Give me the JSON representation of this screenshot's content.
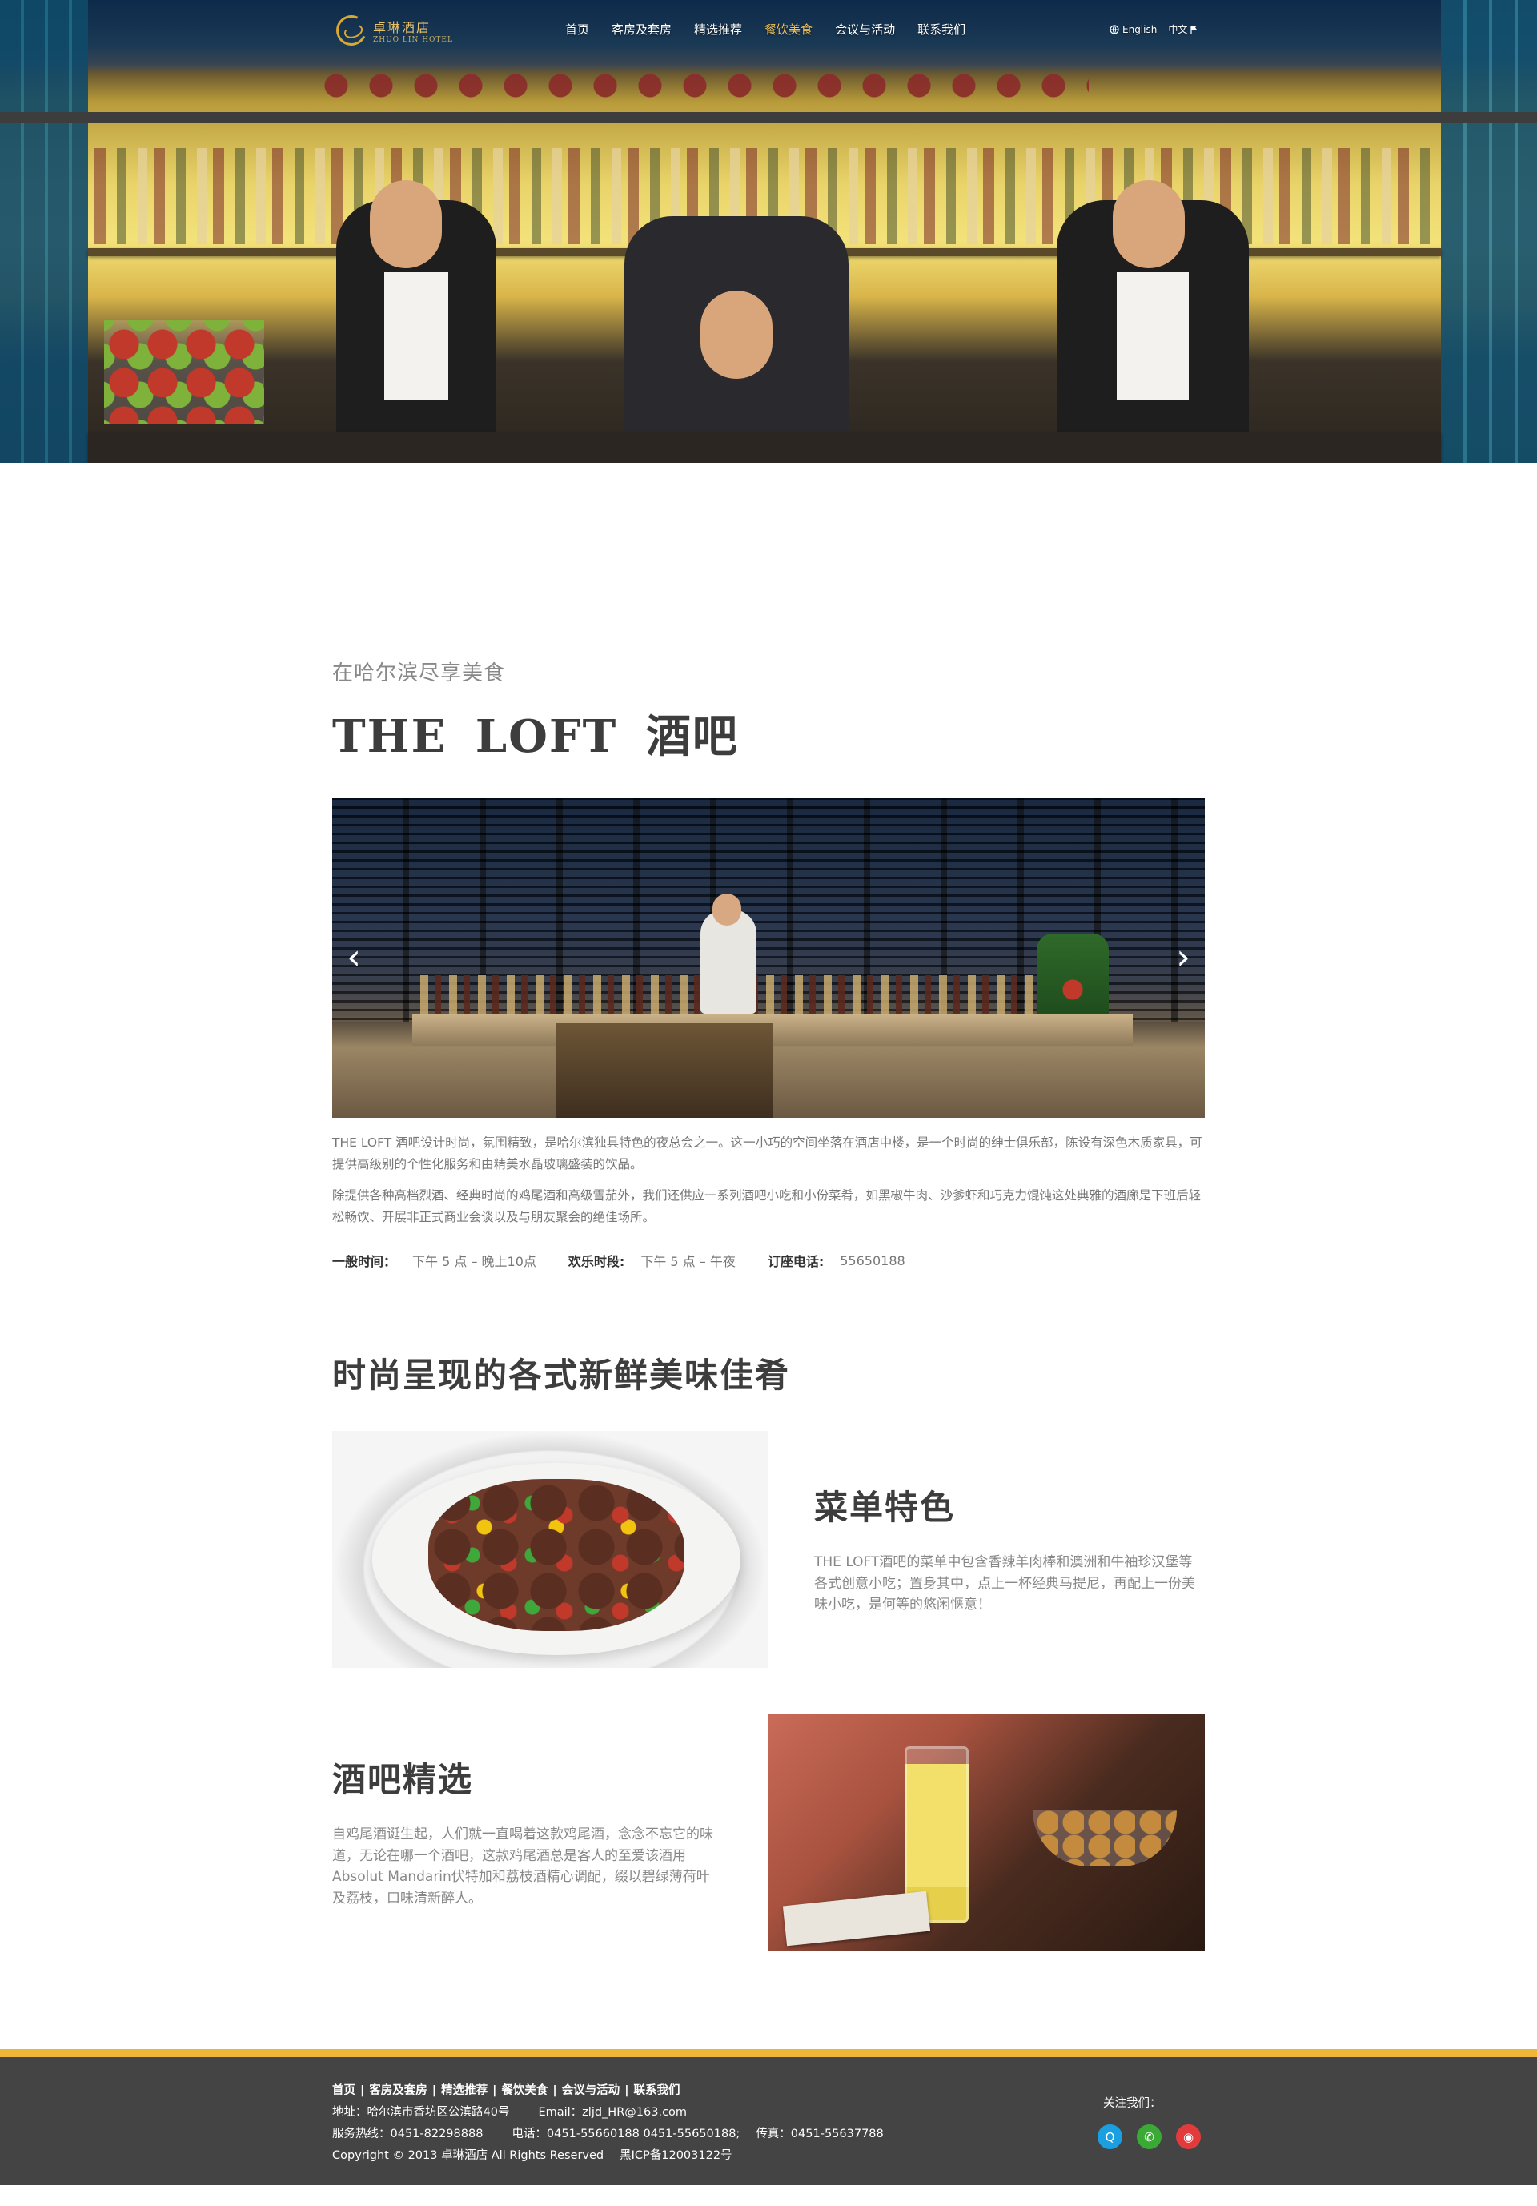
{
  "header": {
    "logo_name": "卓琳酒店",
    "logo_sub": "ZHUO LIN HOTEL",
    "nav": [
      {
        "label": "首页",
        "active": false
      },
      {
        "label": "客房及套房",
        "active": false
      },
      {
        "label": "精选推荐",
        "active": false
      },
      {
        "label": "餐饮美食",
        "active": true
      },
      {
        "label": "会议与活动",
        "active": false
      },
      {
        "label": "联系我们",
        "active": false
      }
    ],
    "lang": {
      "en": "English",
      "cn": "中文"
    }
  },
  "main": {
    "subtitle": "在哈尔滨尽享美食",
    "title": "THE LOFT 酒吧",
    "slider": {
      "prev": "‹",
      "next": "›"
    },
    "desc": [
      "THE LOFT 酒吧设计时尚，氛围精致，是哈尔滨独具特色的夜总会之一。这一小巧的空间坐落在酒店中楼，是一个时尚的绅士俱乐部，陈设有深色木质家具，可提供高级别的个性化服务和由精美水晶玻璃盛装的饮品。",
      "除提供各种高档烈酒、经典时尚的鸡尾酒和高级雪茄外，我们还供应一系列酒吧小吃和小份菜肴，如黑椒牛肉、沙爹虾和巧克力馄饨这处典雅的酒廊是下班后轻松畅饮、开展非正式商业会谈以及与朋友聚会的绝佳场所。"
    ],
    "info": [
      {
        "k": "一般时间：",
        "v": "下午 5 点 – 晚上10点"
      },
      {
        "k": "欢乐时段:",
        "v": "下午 5 点 – 午夜"
      },
      {
        "k": "订座电话:",
        "v": "55650188"
      }
    ],
    "section_title": "时尚呈现的各式新鲜美味佳肴",
    "features": [
      {
        "title": "菜单特色",
        "text": "THE LOFT酒吧的菜单中包含香辣羊肉棒和澳洲和牛袖珍汉堡等各式创意小吃；置身其中，点上一杯经典马提尼，再配上一份美味小吃，是何等的悠闲惬意！"
      },
      {
        "title": "酒吧精选",
        "text": "自鸡尾酒诞生起，人们就一直喝着这款鸡尾酒，念念不忘它的味道，无论在哪一个酒吧，这款鸡尾酒总是客人的至爱该酒用Absolut Mandarin伏特加和荔枝酒精心调配，缀以碧绿薄荷叶及荔枝，口味清新醉人。"
      }
    ]
  },
  "footer": {
    "links": [
      "首页",
      "客房及套房",
      "精选推荐",
      "餐饮美食",
      "会议与活动",
      "联系我们"
    ],
    "address": "地址：哈尔滨市香坊区公滨路40号",
    "email": "Email：zljd_HR@163.com",
    "hotline": "服务热线：0451-82298888",
    "phone": "电话：0451-55660188  0451-55650188;",
    "fax": "传真：0451-55637788",
    "copyright": "Copyright © 2013 卓琳酒店 All Rights Reserved",
    "icp": "黑ICP备12003122号",
    "follow": "关注我们：",
    "social": [
      {
        "name": "qq",
        "glyph": "Q"
      },
      {
        "name": "wechat",
        "glyph": "✆"
      },
      {
        "name": "weibo",
        "glyph": "◉"
      }
    ]
  },
  "colors": {
    "accent": "#efb637",
    "nav_active": "#f0c45a",
    "footer_bg": "#444444",
    "title": "#3d3d3d"
  }
}
